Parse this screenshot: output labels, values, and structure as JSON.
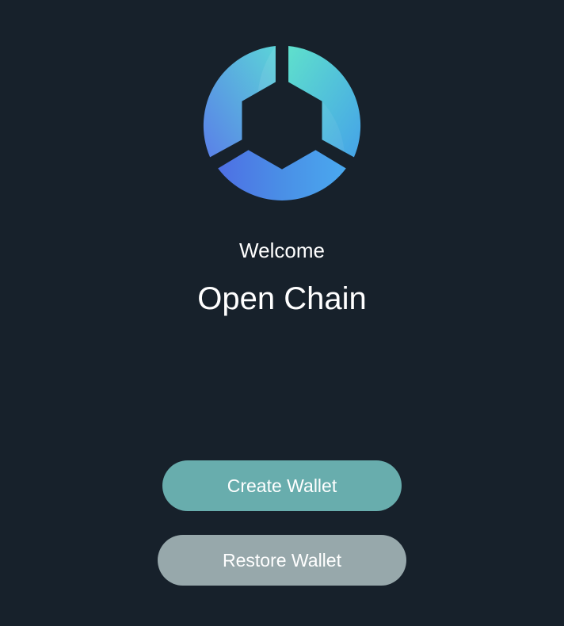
{
  "logo": {
    "icon": "open-chain-logo-icon",
    "colors": [
      "#5fdccd",
      "#4aa9ec",
      "#5878e6"
    ]
  },
  "welcome": {
    "greeting": "Welcome",
    "app_name": "Open Chain"
  },
  "actions": {
    "create_label": "Create Wallet",
    "restore_label": "Restore Wallet"
  },
  "theme": {
    "background": "#17212b",
    "create_button_color": "#68adad",
    "restore_button_color": "#97a8ab"
  }
}
